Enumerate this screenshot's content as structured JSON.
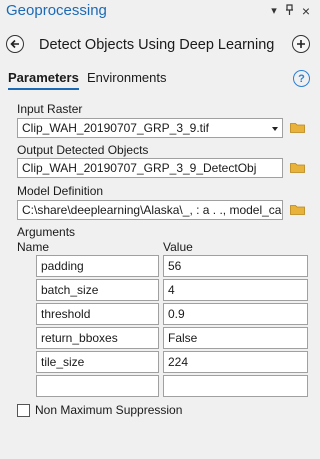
{
  "pane": {
    "title": "Geoprocessing",
    "controls": {
      "menu": "▾",
      "pin": "⊓",
      "close": "×"
    }
  },
  "tool": {
    "title": "Detect Objects Using Deep Learning"
  },
  "tabs": {
    "parameters": "Parameters",
    "environments": "Environments"
  },
  "help": "?",
  "params": {
    "input_raster": {
      "label": "Input Raster",
      "value": "Clip_WAH_20190707_GRP_3_9.tif"
    },
    "output_detected": {
      "label": "Output Detected Objects",
      "value": "Clip_WAH_20190707_GRP_3_9_DetectObj"
    },
    "model_definition": {
      "label": "Model Definition",
      "value": "C:\\share\\deeplearning\\Alaska\\_, : a . ., model_cari"
    }
  },
  "arguments": {
    "label": "Arguments",
    "name_header": "Name",
    "value_header": "Value",
    "rows": [
      {
        "name": "padding",
        "value": "56"
      },
      {
        "name": "batch_size",
        "value": "4"
      },
      {
        "name": "threshold",
        "value": "0.9"
      },
      {
        "name": "return_bboxes",
        "value": "False"
      },
      {
        "name": "tile_size",
        "value": "224"
      },
      {
        "name": "",
        "value": ""
      }
    ]
  },
  "nms": {
    "label": "Non Maximum Suppression",
    "checked": false
  },
  "colors": {
    "accent": "#1c6ab5",
    "folder": "#e8b23b"
  }
}
